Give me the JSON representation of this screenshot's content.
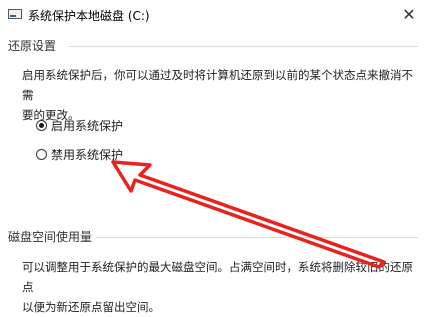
{
  "window": {
    "title": "系统保护本地磁盘 (C:)",
    "close_glyph": "✕"
  },
  "restore": {
    "group_title": "还原设置",
    "description_line1": "启用系统保护后，你可以通过及时将计算机还原到以前的某个状态点来撤消不需",
    "description_line2": "要的更改。",
    "options": [
      {
        "label": "启用系统保护",
        "checked": true
      },
      {
        "label": "禁用系统保护",
        "checked": false
      }
    ]
  },
  "disk": {
    "group_title": "磁盘空间使用量",
    "description_line1": "可以调整用于系统保护的最大磁盘空间。占满空间时，系统将删除较旧的还原点",
    "description_line2": "以便为新还原点留出空间。"
  },
  "colors": {
    "annotation_arrow": "#e8231e"
  }
}
